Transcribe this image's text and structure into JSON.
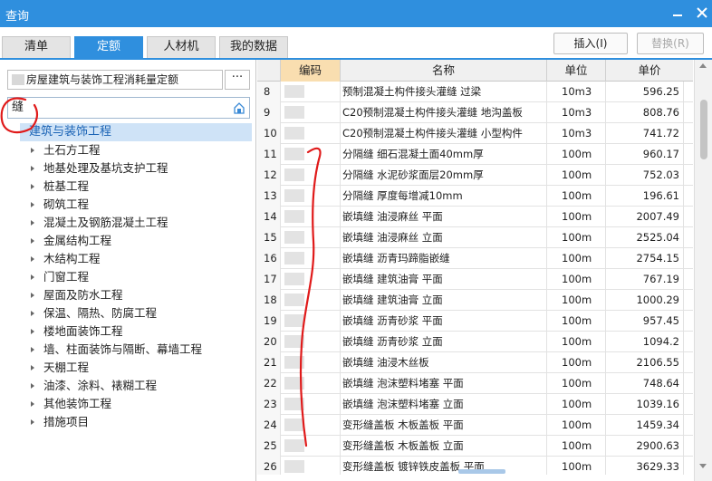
{
  "window": {
    "title": "查询",
    "minimize_icon": "minimize-icon",
    "close_icon": "close-icon",
    "accent": "#2f8fde"
  },
  "tabs": [
    {
      "label": "清单",
      "active": false
    },
    {
      "label": "定额",
      "active": true
    },
    {
      "label": "人材机",
      "active": false
    },
    {
      "label": "我的数据",
      "active": false
    }
  ],
  "toolbar": {
    "insert_label": "插入(I)",
    "replace_label": "替换(R)"
  },
  "left": {
    "quota_library": "房屋建筑与装饰工程消耗量定额",
    "more_label": "···",
    "search_value": "缝",
    "tree": {
      "root": "建筑与装饰工程",
      "children": [
        "土石方工程",
        "地基处理及基坑支护工程",
        "桩基工程",
        "砌筑工程",
        "混凝土及钢筋混凝土工程",
        "金属结构工程",
        "木结构工程",
        "门窗工程",
        "屋面及防水工程",
        "保温、隔热、防腐工程",
        "楼地面装饰工程",
        "墙、柱面装饰与隔断、幕墙工程",
        "天棚工程",
        "油漆、涂料、裱糊工程",
        "其他装饰工程",
        "措施项目"
      ]
    }
  },
  "grid": {
    "columns": {
      "code": "编码",
      "name": "名称",
      "unit": "单位",
      "price": "单价"
    },
    "rows": [
      {
        "idx": "8",
        "name": "预制混凝土构件接头灌缝 过梁",
        "unit": "10m3",
        "price": "596.25"
      },
      {
        "idx": "9",
        "name": "C20预制混凝土构件接头灌缝 地沟盖板",
        "unit": "10m3",
        "price": "808.76"
      },
      {
        "idx": "10",
        "name": "C20预制混凝土构件接头灌缝 小型构件",
        "unit": "10m3",
        "price": "741.72"
      },
      {
        "idx": "11",
        "name": "分隔缝 细石混凝土面40mm厚",
        "unit": "100m",
        "price": "960.17"
      },
      {
        "idx": "12",
        "name": "分隔缝 水泥砂浆面层20mm厚",
        "unit": "100m",
        "price": "752.03"
      },
      {
        "idx": "13",
        "name": "分隔缝 厚度每增减10mm",
        "unit": "100m",
        "price": "196.61"
      },
      {
        "idx": "14",
        "name": "嵌填缝 油浸麻丝 平面",
        "unit": "100m",
        "price": "2007.49"
      },
      {
        "idx": "15",
        "name": "嵌填缝 油浸麻丝 立面",
        "unit": "100m",
        "price": "2525.04"
      },
      {
        "idx": "16",
        "name": "嵌填缝 沥青玛蹄脂嵌缝",
        "unit": "100m",
        "price": "2754.15"
      },
      {
        "idx": "17",
        "name": "嵌填缝 建筑油膏 平面",
        "unit": "100m",
        "price": "767.19"
      },
      {
        "idx": "18",
        "name": "嵌填缝 建筑油膏 立面",
        "unit": "100m",
        "price": "1000.29"
      },
      {
        "idx": "19",
        "name": "嵌填缝 沥青砂浆 平面",
        "unit": "100m",
        "price": "957.45"
      },
      {
        "idx": "20",
        "name": "嵌填缝 沥青砂浆 立面",
        "unit": "100m",
        "price": "1094.2"
      },
      {
        "idx": "21",
        "name": "嵌填缝 油浸木丝板",
        "unit": "100m",
        "price": "2106.55"
      },
      {
        "idx": "22",
        "name": "嵌填缝 泡沫塑料堵塞 平面",
        "unit": "100m",
        "price": "748.64"
      },
      {
        "idx": "23",
        "name": "嵌填缝 泡沫塑料堵塞 立面",
        "unit": "100m",
        "price": "1039.16"
      },
      {
        "idx": "24",
        "name": "变形缝盖板 木板盖板 平面",
        "unit": "100m",
        "price": "1459.34"
      },
      {
        "idx": "25",
        "name": "变形缝盖板 木板盖板 立面",
        "unit": "100m",
        "price": "2900.63"
      },
      {
        "idx": "26",
        "name": "变形缝盖板 镀锌铁皮盖板 平面",
        "unit": "100m",
        "price": "3629.33"
      }
    ]
  }
}
